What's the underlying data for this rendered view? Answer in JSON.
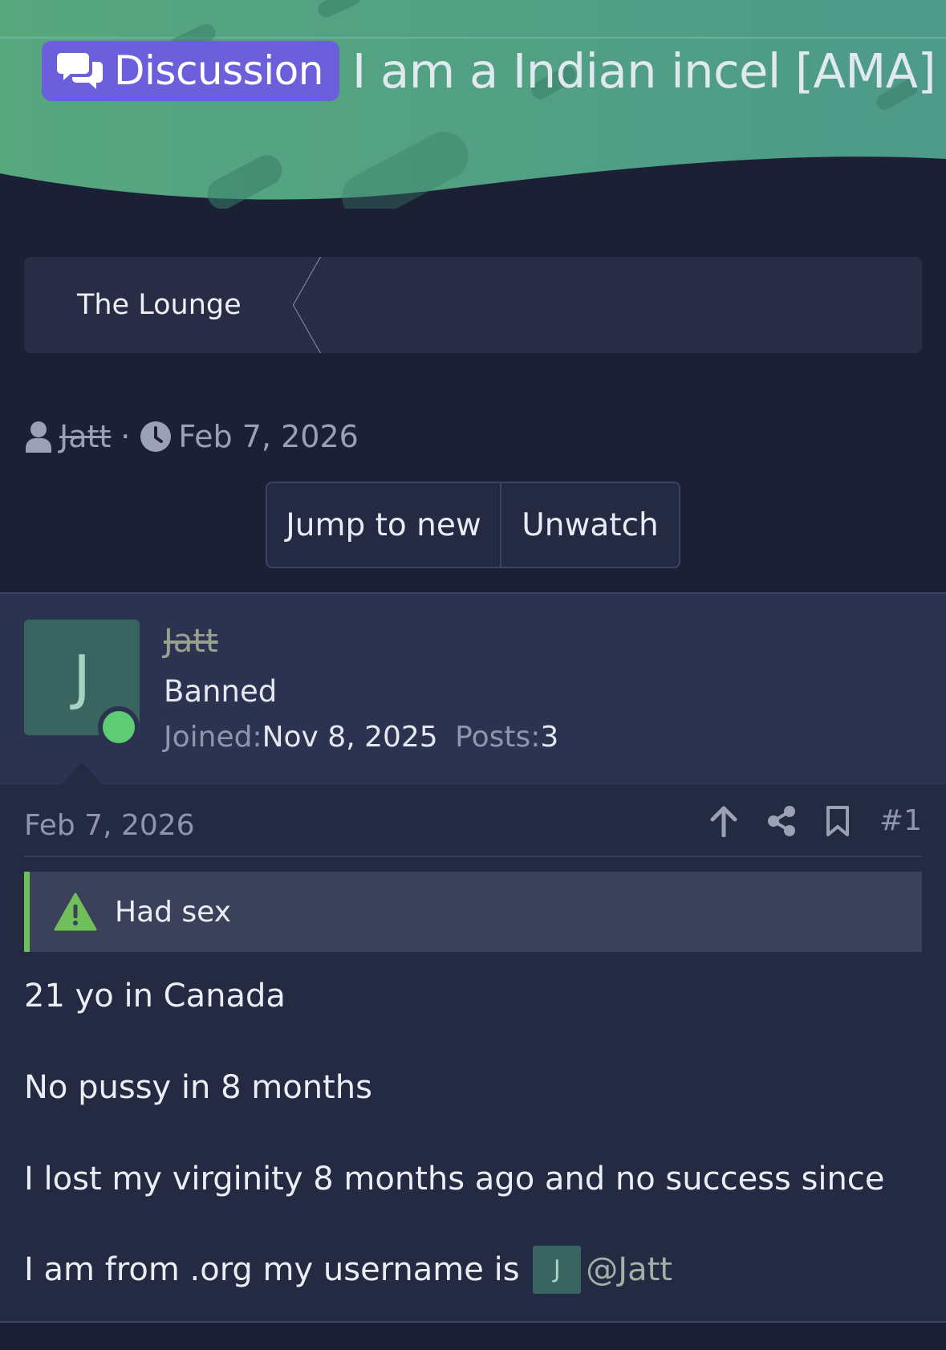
{
  "header": {
    "prefix_label": "Discussion",
    "thread_title": "I am a Indian incel [AMA]"
  },
  "breadcrumb": {
    "items": [
      {
        "label": "The Lounge"
      }
    ]
  },
  "meta": {
    "author": "Jatt",
    "separator": "·",
    "date": "Feb 7, 2026"
  },
  "buttons": {
    "jump_to_new": "Jump to new",
    "unwatch": "Unwatch"
  },
  "post": {
    "user": {
      "avatar_letter": "J",
      "username": "Jatt",
      "title": "Banned",
      "joined_label": "Joined:",
      "joined_value": "Nov 8, 2025",
      "posts_label": "Posts:",
      "posts_value": "3",
      "online": true
    },
    "date": "Feb 7, 2026",
    "number": "#1",
    "prefix_notice": "Had sex",
    "lines": [
      "21 yo in Canada",
      "No pussy in 8 months",
      "I lost my virginity 8 months ago and no success since"
    ],
    "last_line_text": "I am from .org my username is",
    "mention_avatar_letter": "J",
    "mention": "@Jatt"
  },
  "colors": {
    "header_green": "#4e9f86",
    "page_bg": "#1c2035",
    "prefix_purple": "#6b5fdc",
    "online_green": "#5ecb75",
    "notice_green": "#6fbf5a"
  },
  "icons": {
    "prefix": "chat-bubbles-icon",
    "author": "user-icon",
    "date": "clock-icon",
    "upvote": "arrow-up-icon",
    "share": "share-icon",
    "bookmark": "bookmark-icon",
    "notice": "warning-icon"
  }
}
